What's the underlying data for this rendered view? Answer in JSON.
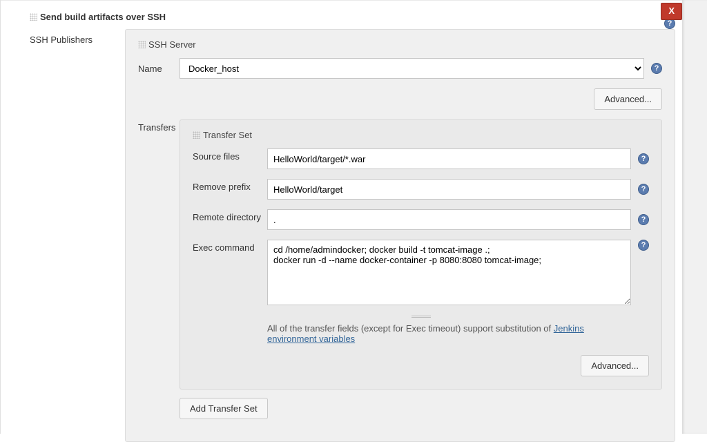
{
  "close_label": "X",
  "section_title": "Send build artifacts over SSH",
  "side_label": "SSH Publishers",
  "ssh_server": {
    "heading": "SSH Server",
    "name_label": "Name",
    "name_value": "Docker_host",
    "advanced_label": "Advanced..."
  },
  "transfers_label": "Transfers",
  "transfer_set": {
    "heading": "Transfer Set",
    "source_label": "Source files",
    "source_value": "HelloWorld/target/*.war",
    "remove_prefix_label": "Remove prefix",
    "remove_prefix_value": "HelloWorld/target",
    "remote_dir_label": "Remote directory",
    "remote_dir_value": ".",
    "exec_label": "Exec command",
    "exec_value": "cd /home/admindocker; docker build -t tomcat-image .;\ndocker run -d --name docker-container -p 8080:8080 tomcat-image;",
    "info_text_pre": "All of the transfer fields (except for Exec timeout) support substitution of ",
    "info_link": "Jenkins environment variables",
    "advanced_label": "Advanced..."
  },
  "add_transfer_label": "Add Transfer Set"
}
